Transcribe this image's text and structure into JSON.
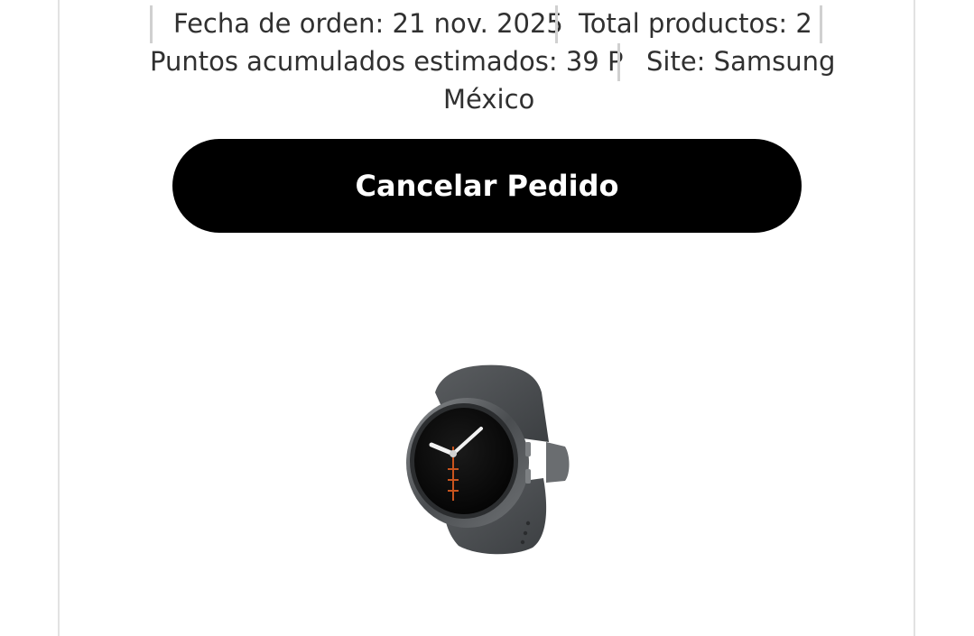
{
  "order_meta": {
    "order_date": "Fecha de orden: 21 nov. 2025",
    "total_products": "Total productos: 2",
    "points": "Puntos acumulados estimados: 39 P",
    "site_line1": "Site: Samsung",
    "site_line2": "México"
  },
  "actions": {
    "cancel_label": "Cancelar Pedido"
  },
  "product": {
    "image_icon": "smartwatch-image"
  },
  "colors": {
    "button_bg": "#000000",
    "button_text": "#ffffff",
    "separator": "#d0d0d0",
    "border": "#e2e2e2"
  }
}
